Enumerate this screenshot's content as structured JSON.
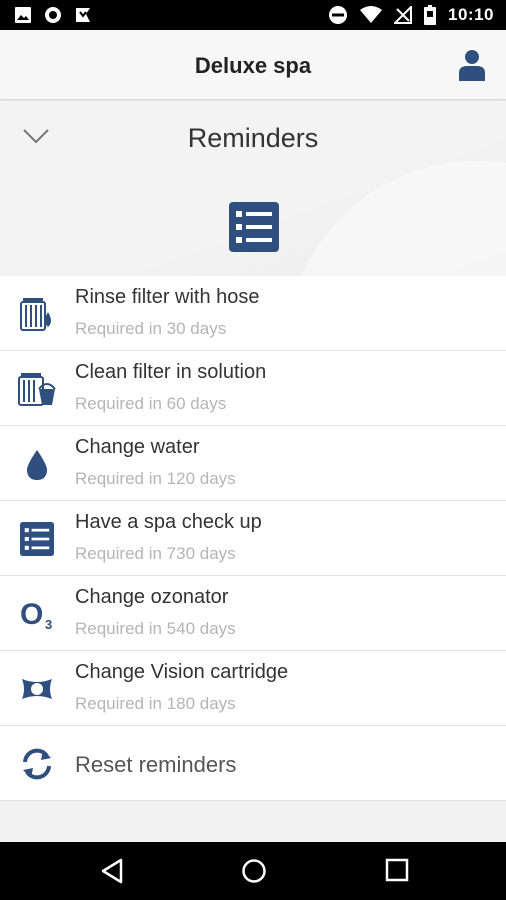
{
  "status_bar": {
    "time": "10:10",
    "left_icons": [
      "image-icon",
      "circle-icon",
      "download-flag-icon"
    ],
    "right_icons": [
      "do-not-disturb-icon",
      "wifi-icon",
      "no-signal-icon",
      "battery-icon"
    ]
  },
  "app_bar": {
    "title": "Deluxe spa",
    "profile_icon": "person-icon"
  },
  "header": {
    "title": "Reminders",
    "collapse_icon": "chevron-down-icon",
    "section_icon": "checklist-icon"
  },
  "reminders": [
    {
      "icon": "filter-hose-icon",
      "label": "Rinse filter with hose",
      "sub": "Required in 30 days"
    },
    {
      "icon": "filter-bucket-icon",
      "label": "Clean filter in solution",
      "sub": "Required in 60 days"
    },
    {
      "icon": "water-drop-icon",
      "label": "Change water",
      "sub": "Required in 120 days"
    },
    {
      "icon": "checklist-icon",
      "label": "Have a spa check up",
      "sub": "Required in 730 days"
    },
    {
      "icon": "ozone-icon",
      "label": "Change ozonator",
      "sub": "Required in 540 days",
      "icon_text": "O",
      "icon_subscript": "3"
    },
    {
      "icon": "vision-cartridge-icon",
      "label": "Change Vision cartridge",
      "sub": "Required in 180 days"
    }
  ],
  "reset": {
    "icon": "refresh-icon",
    "label": "Reset reminders"
  },
  "nav_bar": {
    "icons": [
      "back-icon",
      "home-icon",
      "recents-icon"
    ]
  },
  "colors": {
    "accent": "#2f4f7f",
    "text": "#333333",
    "subtext": "#b5b5b5"
  }
}
